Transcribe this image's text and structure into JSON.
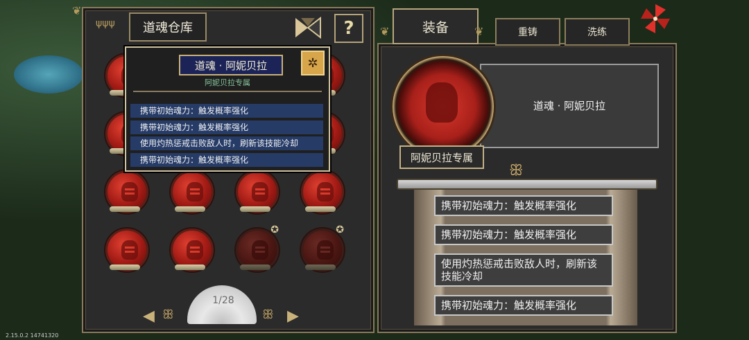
{
  "left_panel": {
    "title": "道魂仓库",
    "help_label": "?",
    "page_indicator": "1/28",
    "souls": [
      {
        "state": "active"
      },
      {
        "state": "active"
      },
      {
        "state": "active"
      },
      {
        "state": "active"
      },
      {
        "state": "active"
      },
      {
        "state": "active"
      },
      {
        "state": "active"
      },
      {
        "state": "active"
      },
      {
        "state": "active"
      },
      {
        "state": "active"
      },
      {
        "state": "active"
      },
      {
        "state": "active"
      },
      {
        "state": "active"
      },
      {
        "state": "active"
      },
      {
        "state": "locked"
      },
      {
        "state": "locked"
      }
    ]
  },
  "tooltip": {
    "name": "道魂 · 阿妮贝拉",
    "subtitle": "阿妮贝拉专属",
    "effects": [
      "携带初始魂力：触发概率强化",
      "携带初始魂力：触发概率强化",
      "使用灼热惩戒击败敌人时，刷新该技能冷却",
      "携带初始魂力：触发概率强化"
    ]
  },
  "right_panel": {
    "tabs": [
      {
        "label": "装备",
        "active": true
      },
      {
        "label": "重铸",
        "active": false
      },
      {
        "label": "洗练",
        "active": false
      }
    ],
    "item_name": "道魂 · 阿妮贝拉",
    "exclusive_label": "阿妮贝拉专属",
    "effects": [
      "携带初始魂力：触发概率强化",
      "携带初始魂力：触发概率强化",
      "使用灼热惩戒击败敌人时，刷新该技能冷却",
      "携带初始魂力：触发概率强化"
    ]
  },
  "version_text": "2.15.0.2 14741320",
  "colors": {
    "soul_red": "#c4271d",
    "tooltip_line_bg": "#263b66",
    "accent_gold": "#c9b27a"
  }
}
